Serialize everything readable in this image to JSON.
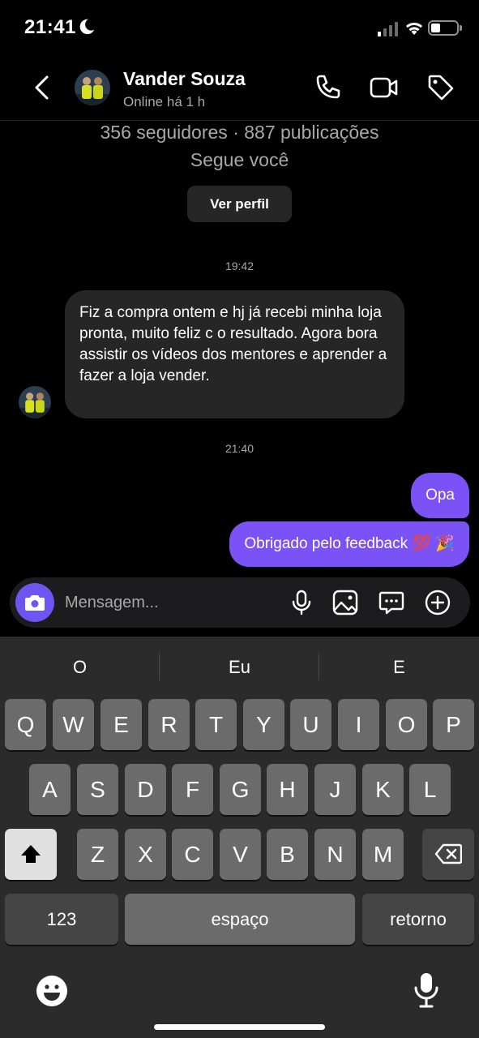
{
  "status_bar": {
    "time": "21:41",
    "battery_level": 0.35
  },
  "header": {
    "back_icon": "chevron-left-icon",
    "name": "Vander Souza",
    "status": "Online há 1 h",
    "actions": [
      "phone-icon",
      "video-call-icon",
      "tag-icon"
    ]
  },
  "profile": {
    "stats": "356 seguidores · 887 publicações",
    "follows_you": "Segue você",
    "view_profile": "Ver perfil"
  },
  "messages": {
    "timestamp_1": "19:42",
    "received_1": "Fiz a compra ontem e hj já recebi minha loja pronta, muito feliz c o resultado. Agora bora assistir os vídeos dos mentores e aprender a fazer a loja vender.",
    "timestamp_2": "21:40",
    "sent_1": "Opa",
    "sent_2": "Obrigado pelo feedback 💯 🎉"
  },
  "composer": {
    "placeholder": "Mensagem...",
    "icons": [
      "camera-icon",
      "mic-icon",
      "gallery-icon",
      "sticker-icon",
      "plus-icon"
    ]
  },
  "keyboard": {
    "suggestions": [
      "O",
      "Eu",
      "E"
    ],
    "row1": [
      "Q",
      "W",
      "E",
      "R",
      "T",
      "Y",
      "U",
      "I",
      "O",
      "P"
    ],
    "row2": [
      "A",
      "S",
      "D",
      "F",
      "G",
      "H",
      "J",
      "K",
      "L"
    ],
    "row3": [
      "Z",
      "X",
      "C",
      "V",
      "B",
      "N",
      "M"
    ],
    "numbers_key": "123",
    "space_key": "espaço",
    "return_key": "retorno"
  },
  "colors": {
    "accent": "#7b52f5",
    "background": "#000000",
    "bubble_received": "#262626",
    "keyboard_bg": "#2b2b2b"
  }
}
